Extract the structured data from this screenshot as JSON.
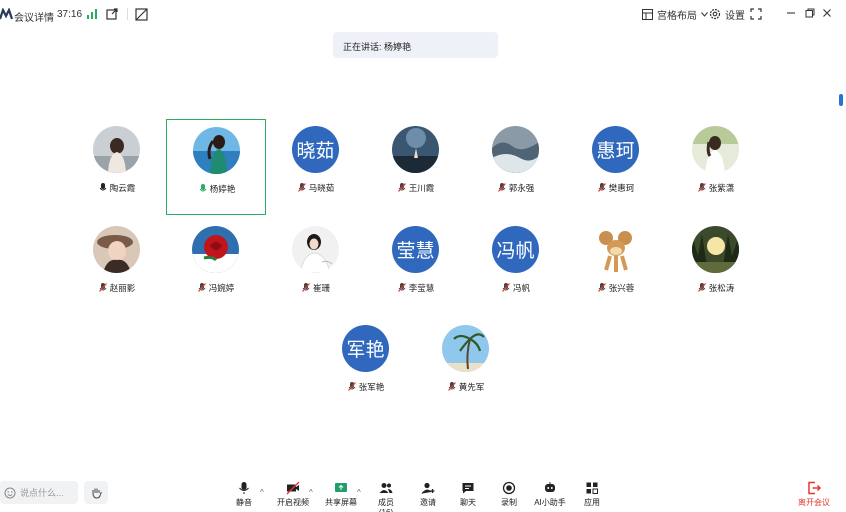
{
  "topbar": {
    "info_label": "会议详情",
    "timer": "37:16",
    "layout_label": "宫格布局",
    "settings_label": "设置"
  },
  "speaking": {
    "text": "正在讲话: 杨婷艳"
  },
  "participants": [
    {
      "name": "陶云霞",
      "avatar": "photo-woman-back",
      "mic": "on"
    },
    {
      "name": "杨婷艳",
      "avatar": "photo-woman-sea",
      "mic": "speaking",
      "active": true
    },
    {
      "name": "马晓茹",
      "avatar_text": "晓茹",
      "mic": "muted"
    },
    {
      "name": "王川霞",
      "avatar": "photo-sky-dark",
      "mic": "muted"
    },
    {
      "name": "郭永强",
      "avatar": "photo-waves",
      "mic": "muted"
    },
    {
      "name": "樊惠珂",
      "avatar_text": "惠珂",
      "mic": "muted"
    },
    {
      "name": "张紫潇",
      "avatar": "photo-woman-garden",
      "mic": "muted"
    },
    {
      "name": "赵丽影",
      "avatar": "photo-woman-hat",
      "mic": "muted"
    },
    {
      "name": "冯婉婷",
      "avatar": "photo-rose",
      "mic": "muted"
    },
    {
      "name": "崔珊",
      "avatar": "photo-woman-white",
      "mic": "muted"
    },
    {
      "name": "李莹慧",
      "avatar_text": "莹慧",
      "mic": "muted"
    },
    {
      "name": "冯帆",
      "avatar_text": "冯帆",
      "mic": "muted"
    },
    {
      "name": "张兴蓉",
      "avatar": "cartoon-mouse",
      "mic": "muted"
    },
    {
      "name": "张松涛",
      "avatar": "photo-forest",
      "mic": "muted"
    },
    {
      "name": "张军艳",
      "avatar_text": "军艳",
      "mic": "muted"
    },
    {
      "name": "黄先军",
      "avatar": "photo-palm",
      "mic": "muted"
    }
  ],
  "bottombar": {
    "chat_placeholder": "说点什么...",
    "mute": "静音",
    "video": "开启视频",
    "share": "共享屏幕",
    "members": "成员(16)",
    "invite": "邀请",
    "chat": "聊天",
    "record": "录制",
    "ai": "AI小助手",
    "apps": "应用",
    "leave": "离开会议"
  },
  "colors": {
    "accent": "#2f68bd",
    "active_border": "#27ae60",
    "leave": "#e23a2e"
  }
}
